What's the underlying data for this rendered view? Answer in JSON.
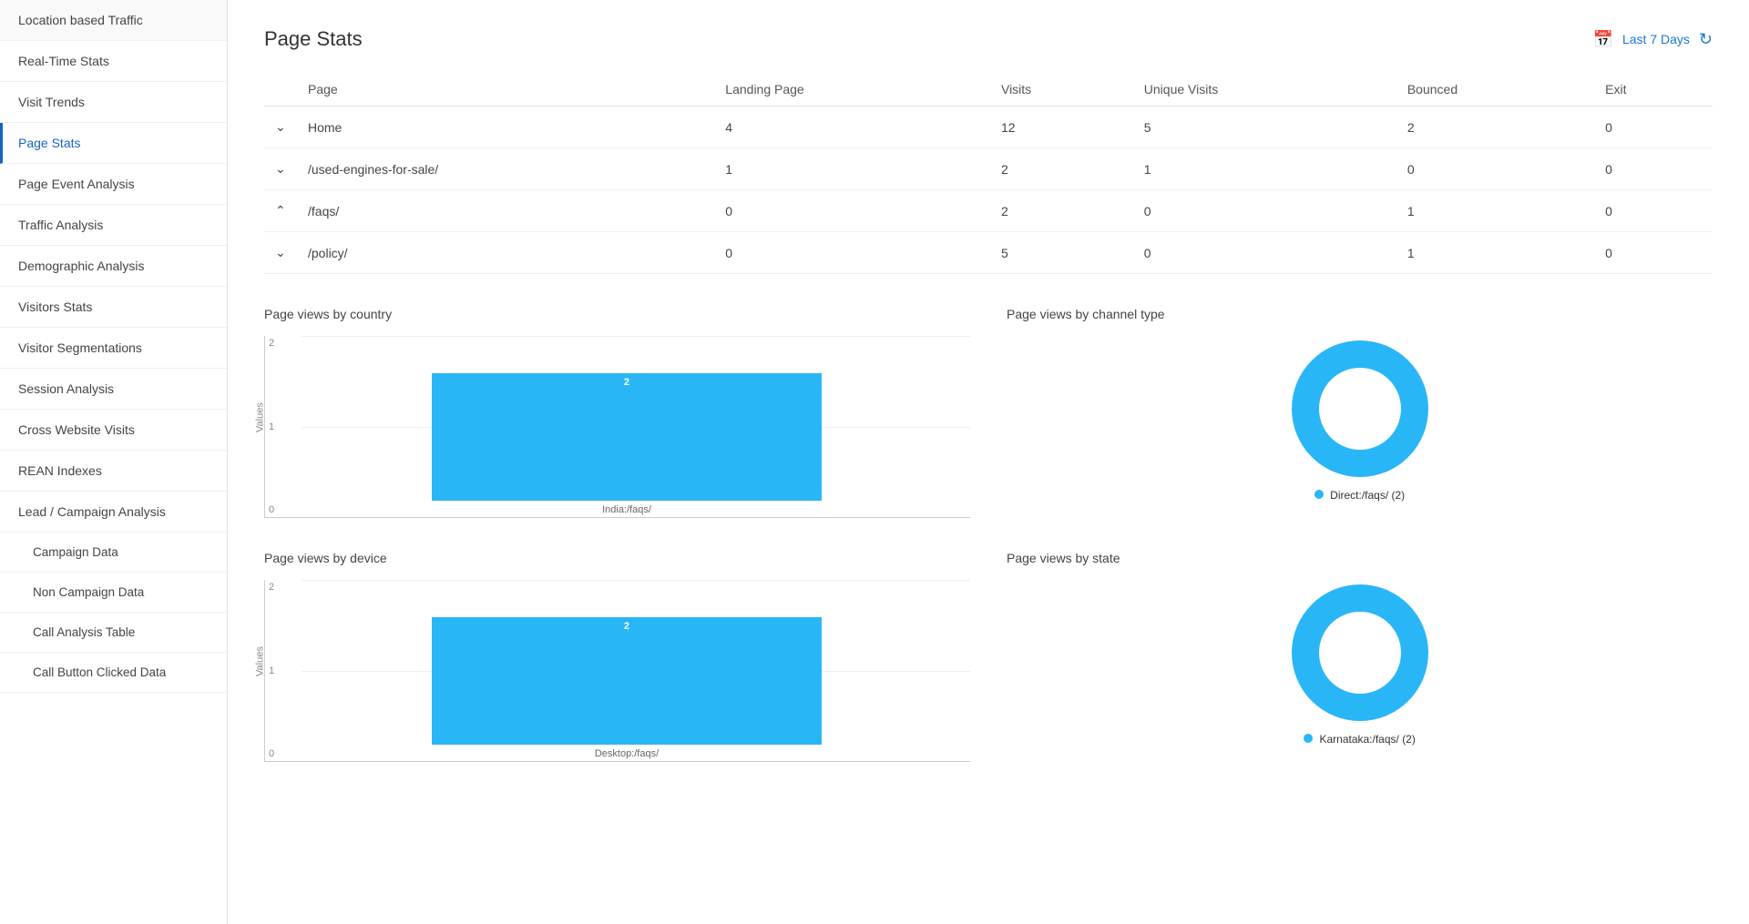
{
  "sidebar": {
    "items": [
      {
        "label": "Location based Traffic",
        "active": false,
        "sub": false
      },
      {
        "label": "Real-Time Stats",
        "active": false,
        "sub": false
      },
      {
        "label": "Visit Trends",
        "active": false,
        "sub": false
      },
      {
        "label": "Page Stats",
        "active": true,
        "sub": false
      },
      {
        "label": "Page Event Analysis",
        "active": false,
        "sub": false
      },
      {
        "label": "Traffic Analysis",
        "active": false,
        "sub": false
      },
      {
        "label": "Demographic Analysis",
        "active": false,
        "sub": false
      },
      {
        "label": "Visitors Stats",
        "active": false,
        "sub": false
      },
      {
        "label": "Visitor Segmentations",
        "active": false,
        "sub": false
      },
      {
        "label": "Session Analysis",
        "active": false,
        "sub": false
      },
      {
        "label": "Cross Website Visits",
        "active": false,
        "sub": false
      },
      {
        "label": "REAN Indexes",
        "active": false,
        "sub": false
      },
      {
        "label": "Lead / Campaign Analysis",
        "active": false,
        "sub": false
      },
      {
        "label": "Campaign Data",
        "active": false,
        "sub": true
      },
      {
        "label": "Non Campaign Data",
        "active": false,
        "sub": true
      },
      {
        "label": "Call Analysis Table",
        "active": false,
        "sub": true
      },
      {
        "label": "Call Button Clicked Data",
        "active": false,
        "sub": true
      }
    ]
  },
  "header": {
    "title": "Page Stats",
    "date_range": "Last 7 Days"
  },
  "table": {
    "columns": [
      "Page",
      "Landing Page",
      "Visits",
      "Unique Visits",
      "Bounced",
      "Exit"
    ],
    "rows": [
      {
        "chevron": "down",
        "page": "Home",
        "landing": "4",
        "visits": "12",
        "unique": "5",
        "bounced": "2",
        "exit": "0"
      },
      {
        "chevron": "down",
        "page": "/used-engines-for-sale/",
        "landing": "1",
        "visits": "2",
        "unique": "1",
        "bounced": "0",
        "exit": "0"
      },
      {
        "chevron": "up",
        "page": "/faqs/",
        "landing": "0",
        "visits": "2",
        "unique": "0",
        "bounced": "1",
        "exit": "0"
      },
      {
        "chevron": "down",
        "page": "/policy/",
        "landing": "0",
        "visits": "5",
        "unique": "0",
        "bounced": "1",
        "exit": "0"
      }
    ]
  },
  "charts": {
    "country": {
      "title": "Page views by country",
      "y_labels": [
        "2",
        "1",
        "0"
      ],
      "y_axis_title": "Values",
      "bars": [
        {
          "value": 2,
          "label": "India:/faqs/",
          "height_pct": 100
        }
      ]
    },
    "channel": {
      "title": "Page views by channel type",
      "legend": "Direct:/faqs/ (2)"
    },
    "device": {
      "title": "Page views by device",
      "y_labels": [
        "2",
        "1",
        "0"
      ],
      "y_axis_title": "Values",
      "bars": [
        {
          "value": 2,
          "label": "Desktop:/faqs/",
          "height_pct": 100
        }
      ]
    },
    "state": {
      "title": "Page views by state",
      "legend": "Karnataka:/faqs/ (2)"
    }
  }
}
